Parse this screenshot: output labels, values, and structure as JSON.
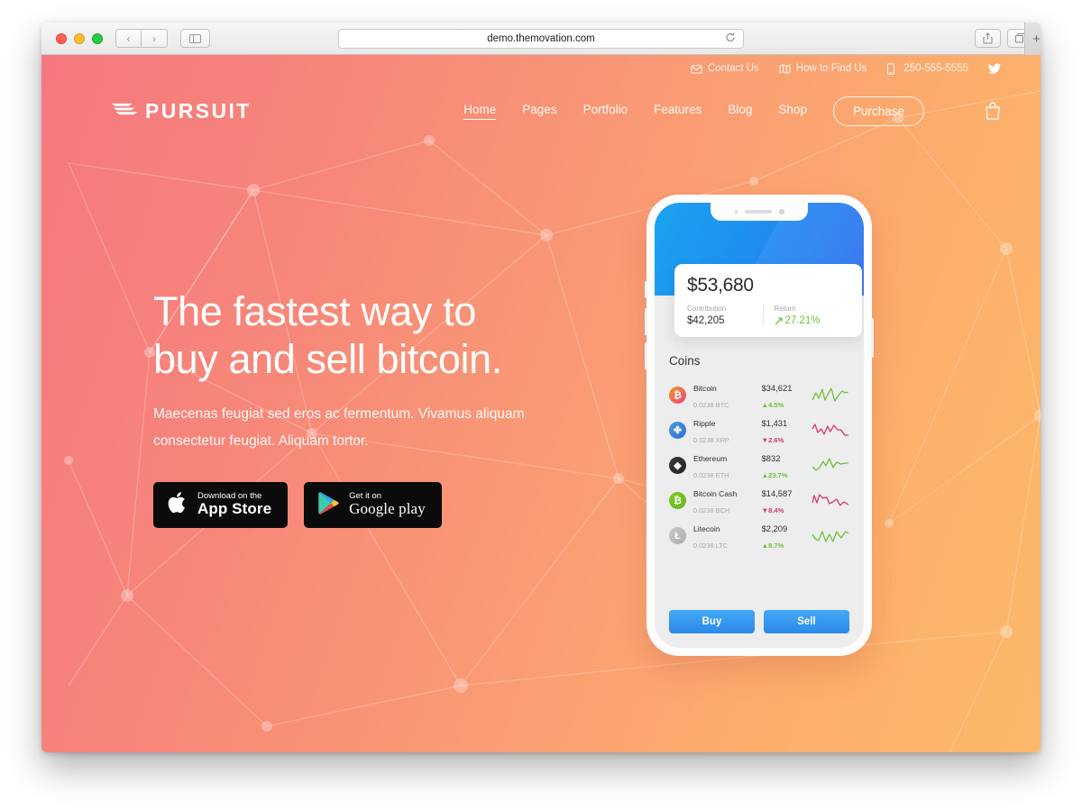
{
  "browser": {
    "url": "demo.themovation.com",
    "reload_icon": "reload-icon",
    "back_icon": "‹",
    "forward_icon": "›",
    "sidebar_icon": "sidebar-icon",
    "share_icon": "share-icon",
    "tabs_icon": "tabs-icon",
    "new_tab_icon": "+"
  },
  "topbar": {
    "items": [
      {
        "label": "Contact Us",
        "icon": "envelope-icon"
      },
      {
        "label": "How to Find Us",
        "icon": "map-icon"
      },
      {
        "label": "250-555-5555",
        "icon": "phone-icon"
      }
    ],
    "social": {
      "icon": "twitter-icon",
      "label": ""
    }
  },
  "nav": {
    "logo": {
      "text": "PURSUIT",
      "icon": "wing-logo-icon"
    },
    "links": [
      {
        "label": "Home",
        "active": true
      },
      {
        "label": "Pages",
        "active": false
      },
      {
        "label": "Portfolio",
        "active": false
      },
      {
        "label": "Features",
        "active": false
      },
      {
        "label": "Blog",
        "active": false
      },
      {
        "label": "Shop",
        "active": false
      }
    ],
    "purchase_label": "Purchase",
    "cart_icon": "shopping-bag-icon"
  },
  "hero": {
    "headline_line1": "The fastest way to",
    "headline_line2": "buy and sell bitcoin.",
    "subtext": "Maecenas feugiat sed eros ac fermentum. Vivamus aliquam consectetur feugiat. Aliquam tortor.",
    "badges": [
      {
        "small": "Download on the",
        "big": "App Store",
        "icon": "apple-icon"
      },
      {
        "small": "Get it on",
        "big": "Google play",
        "icon": "google-play-icon"
      }
    ]
  },
  "phone": {
    "balance": {
      "amount": "$53,680",
      "contribution_label": "Contribution",
      "contribution_value": "$42,205",
      "return_label": "Return",
      "return_value": "27.21%",
      "return_icon": "arrow-up-right-icon"
    },
    "coins_title": "Coins",
    "coins": [
      {
        "name": "Bitcoin",
        "amount": "0.0238 BTC",
        "price": "$34,621",
        "change": "4.5%",
        "direction": "up",
        "symbol": "₿",
        "color": "#f7931a",
        "color2": "#e8458b",
        "spark": "up"
      },
      {
        "name": "Ripple",
        "amount": "0.0238 XRP",
        "price": "$1,431",
        "change": "2.6%",
        "direction": "down",
        "symbol": "✤",
        "color": "#3b8fe0",
        "color2": "#2f6fd0",
        "spark": "down"
      },
      {
        "name": "Ethereum",
        "amount": "0.0238 ETH",
        "price": "$832",
        "change": "23.7%",
        "direction": "up",
        "symbol": "◆",
        "color": "#2e2e2e",
        "color2": "#3b3b3b",
        "spark": "up"
      },
      {
        "name": "Bitcoin Cash",
        "amount": "0.0238 BCH",
        "price": "$14,587",
        "change": "8.4%",
        "direction": "down",
        "symbol": "₿",
        "color": "#74c225",
        "color2": "#6bb520",
        "spark": "down"
      },
      {
        "name": "Litecoin",
        "amount": "0.0238 LTC",
        "price": "$2,209",
        "change": "8.7%",
        "direction": "up",
        "symbol": "Ł",
        "color": "#bfbfbf",
        "color2": "#b0b0b0",
        "spark": "up"
      }
    ],
    "buy_label": "Buy",
    "sell_label": "Sell"
  },
  "colors": {
    "gradient_start": "#f5787f",
    "gradient_end": "#fcb86a",
    "up": "#6fbf3a",
    "down": "#d6376a",
    "action_blue": "#2b8ae8"
  }
}
